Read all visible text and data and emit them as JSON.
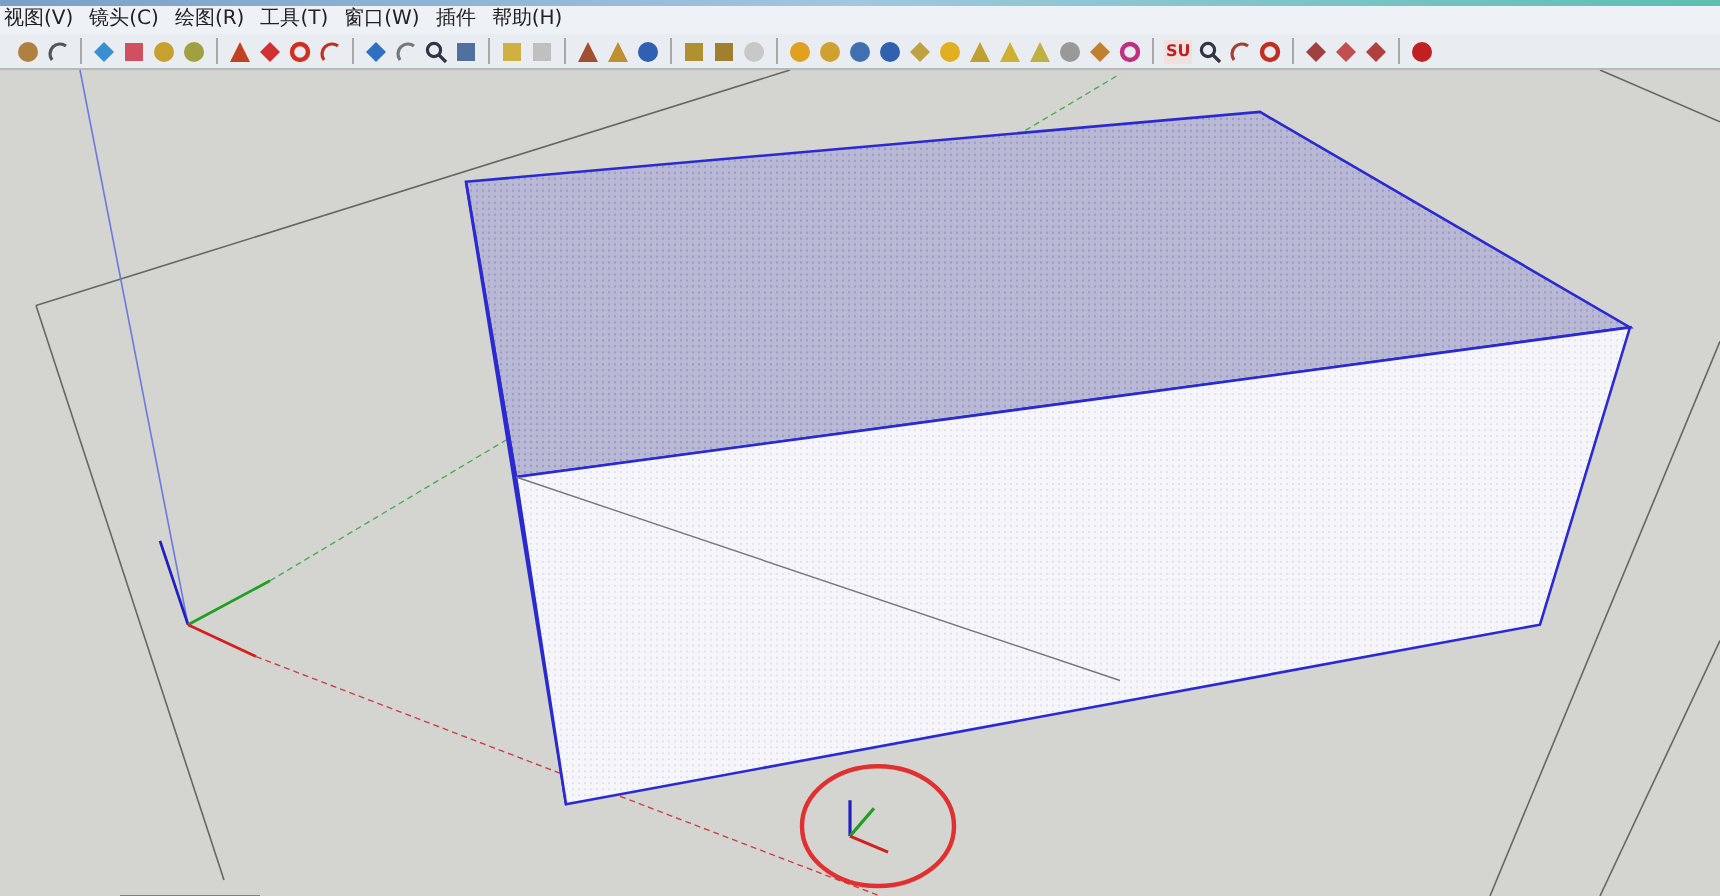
{
  "menu": [
    {
      "label": "视图(V)"
    },
    {
      "label": "镜头(C)"
    },
    {
      "label": "绘图(R)"
    },
    {
      "label": "工具(T)"
    },
    {
      "label": "窗口(W)"
    },
    {
      "label": "插件"
    },
    {
      "label": "帮助(H)"
    }
  ],
  "toolbar": {
    "badge": "SU"
  }
}
